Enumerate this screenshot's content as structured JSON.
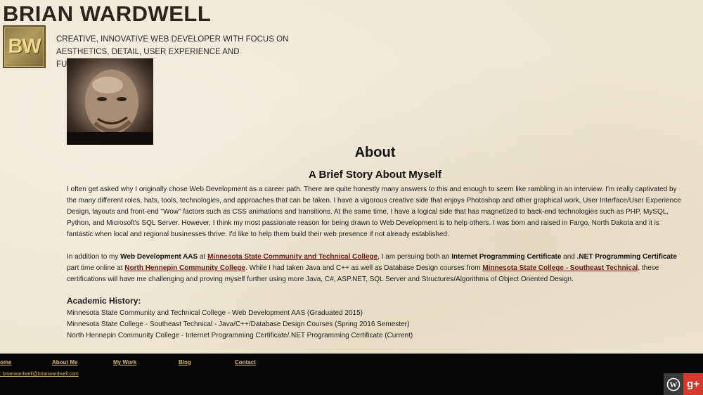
{
  "header": {
    "site_name": "BRIAN WARDWELL",
    "logo_text": "BW",
    "tagline": "CREATIVE, INNOVATIVE WEB DEVELOPER WITH FOCUS ON AESTHETICS, DETAIL, USER EXPERIENCE AND FUNCTIONALITY."
  },
  "about": {
    "title": "About",
    "subtitle": "A Brief Story About Myself",
    "paragraph1": "I often get asked why I originally chose Web Development as a career path. There are quite honestly many answers to this and enough to seem like rambling in an interview. I'm really captivated by the many different roles, hats, tools, technologies, and approaches that can be taken. I have a vigorous creative side that enjoys Photoshop and other graphical work, User Interface/User Experience Design, layouts and front-end \"Wow\" factors such as CSS animations and transitions. At the same time, I have a logical side that has magnetized to back-end technologies such as PHP, MySQL, Python, and Microsoft's SQL Server. However, I think my most passionate reason for being drawn to Web Development is to help others. I was born and raised in Fargo, North Dakota and it is fantastic when local and regional businesses thrive. I'd like to help them build their web presence if not already established.",
    "p2": {
      "t1": "In addition to my ",
      "b1": "Web Development AAS",
      "t2": " at ",
      "link1": "Minnesota State Community and Technical College",
      "t3": ", I am persuing both an ",
      "b2": "Internet Programming Certificate",
      "t4": " and ",
      "b3": ".NET Programming Certificate",
      "t5": " part time online at ",
      "link2": "North Hennepin Community College",
      "t6": ". While I had taken Java and C++ as well as Database Design courses from ",
      "link3": "Minnesota State College - Southeast Technical",
      "t7": ", these certifications will have me challenging and proving myself further using more Java, C#, ASP.NET, SQL Server and Structures/Algorithms of Object Oriented Design."
    },
    "history_title": "Academic History:",
    "history": [
      "Minnesota State Community and Technical College - Web Development AAS (Graduated 2015)",
      "Minnesota State College - Southeast Technical - Java/C++/Database Design Courses (Spring 2016 Semester)",
      "North Hennepin Community College - Internet Programming Certificate/.NET Programming Certificate (Current)"
    ]
  },
  "footer": {
    "nav": [
      "ome",
      "About Me",
      "My Work",
      "Blog",
      "Contact"
    ],
    "email": ": brianwardwell@brianwardwell.com",
    "social_wp": "W",
    "social_gp": "g+"
  },
  "colors": {
    "background": "#efe6d2",
    "link": "#6b1a12",
    "footer_bg": "#060606",
    "footer_link": "#d9b86a",
    "gplus": "#d43a2c"
  }
}
